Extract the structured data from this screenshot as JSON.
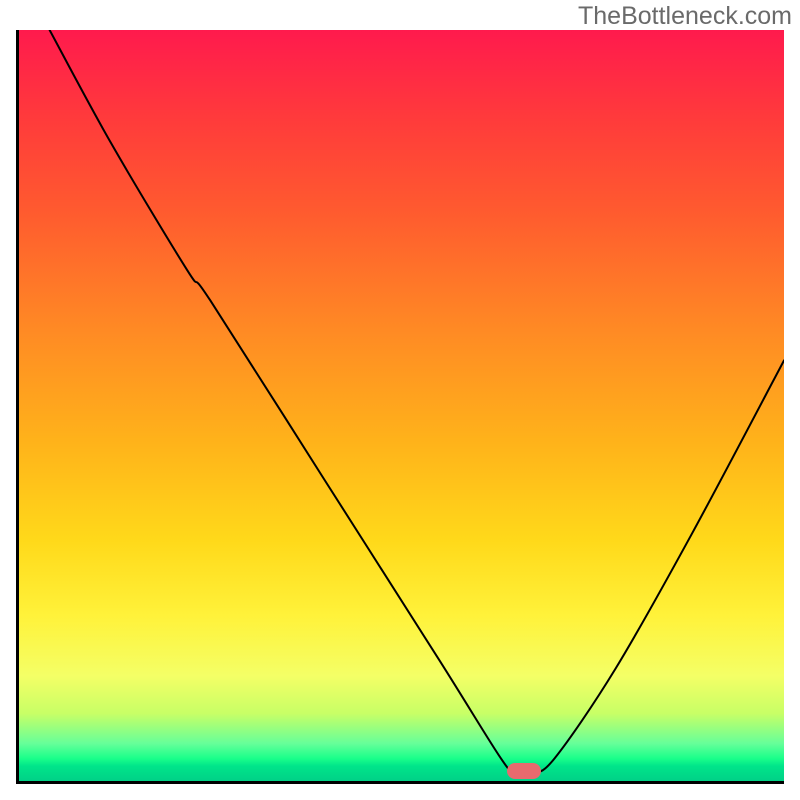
{
  "watermark": "TheBottleneck.com",
  "chart_data": {
    "type": "line",
    "title": "",
    "xlabel": "",
    "ylabel": "",
    "xlim": [
      0,
      100
    ],
    "ylim": [
      0,
      100
    ],
    "series": [
      {
        "name": "bottleneck-curve",
        "x": [
          4,
          12,
          22,
          25,
          40,
          55,
          63,
          65,
          67,
          70,
          78,
          88,
          100
        ],
        "y": [
          100,
          85,
          68,
          64,
          40,
          16,
          3,
          1,
          1,
          3,
          15,
          33,
          56
        ]
      }
    ],
    "marker": {
      "x": 66,
      "y": 1.3
    },
    "gradient_stops": [
      {
        "pos": 0,
        "color": "#ff1a4d"
      },
      {
        "pos": 12,
        "color": "#ff3b3b"
      },
      {
        "pos": 24,
        "color": "#ff5a2f"
      },
      {
        "pos": 40,
        "color": "#ff8a24"
      },
      {
        "pos": 55,
        "color": "#ffb31a"
      },
      {
        "pos": 68,
        "color": "#ffd91a"
      },
      {
        "pos": 78,
        "color": "#fff23a"
      },
      {
        "pos": 86,
        "color": "#f4ff66"
      },
      {
        "pos": 91,
        "color": "#c8ff66"
      },
      {
        "pos": 95,
        "color": "#66ff99"
      },
      {
        "pos": 97,
        "color": "#1aff8a"
      },
      {
        "pos": 98,
        "color": "#00e58a"
      },
      {
        "pos": 100,
        "color": "#00d187"
      }
    ]
  }
}
